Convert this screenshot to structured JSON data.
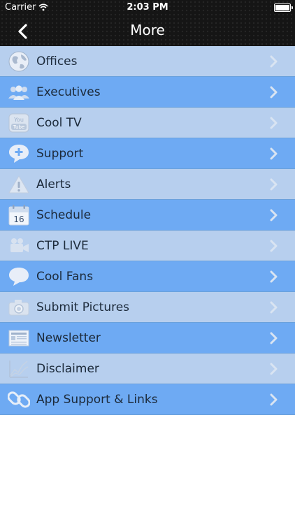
{
  "status": {
    "carrier": "Carrier",
    "time": "2:03 PM"
  },
  "nav": {
    "title": "More"
  },
  "menu": [
    {
      "label": "Offices",
      "icon": "globe-icon"
    },
    {
      "label": "Executives",
      "icon": "people-icon"
    },
    {
      "label": "Cool TV",
      "icon": "tube-icon"
    },
    {
      "label": "Support",
      "icon": "support-bubble-icon"
    },
    {
      "label": "Alerts",
      "icon": "warning-icon"
    },
    {
      "label": "Schedule",
      "icon": "calendar-icon"
    },
    {
      "label": "CTP LIVE",
      "icon": "video-camera-icon"
    },
    {
      "label": "Cool Fans",
      "icon": "speech-bubble-icon"
    },
    {
      "label": "Submit Pictures",
      "icon": "camera-icon"
    },
    {
      "label": "Newsletter",
      "icon": "newspaper-icon"
    },
    {
      "label": "Disclaimer",
      "icon": "chart-icon"
    },
    {
      "label": "App Support & Links",
      "icon": "link-icon"
    }
  ],
  "icon_text": {
    "tube_line1": "You",
    "tube_line2": "Tube",
    "calendar_day": "16"
  },
  "colors": {
    "row_light": "#b7cfee",
    "row_dark": "#6eaaf3",
    "header": "#151515"
  }
}
